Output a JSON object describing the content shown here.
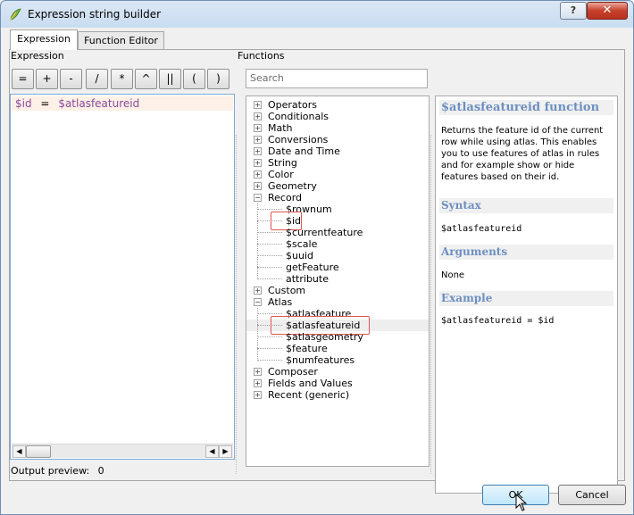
{
  "window": {
    "title": "Expression string builder"
  },
  "tabs": [
    {
      "label": "Expression",
      "active": true
    },
    {
      "label": "Function Editor",
      "active": false
    }
  ],
  "expression": {
    "section_label": "Expression",
    "operators": [
      "=",
      "+",
      "-",
      "/",
      "*",
      "^",
      "||",
      "(",
      ")"
    ],
    "text_var1": "$id",
    "text_op": "=",
    "text_var2": "$atlasfeatureid",
    "output_preview_label": "Output preview:",
    "output_preview_value": "0"
  },
  "functions": {
    "section_label": "Functions",
    "search_placeholder": "Search",
    "tree": [
      {
        "label": "Operators",
        "level": 0,
        "expander": "+"
      },
      {
        "label": "Conditionals",
        "level": 0,
        "expander": "+"
      },
      {
        "label": "Math",
        "level": 0,
        "expander": "+"
      },
      {
        "label": "Conversions",
        "level": 0,
        "expander": "+"
      },
      {
        "label": "Date and Time",
        "level": 0,
        "expander": "+"
      },
      {
        "label": "String",
        "level": 0,
        "expander": "+"
      },
      {
        "label": "Color",
        "level": 0,
        "expander": "+"
      },
      {
        "label": "Geometry",
        "level": 0,
        "expander": "+"
      },
      {
        "label": "Record",
        "level": 0,
        "expander": "-"
      },
      {
        "label": "$rownum",
        "level": 1
      },
      {
        "label": "$id",
        "level": 1,
        "highlighted": true
      },
      {
        "label": "$currentfeature",
        "level": 1
      },
      {
        "label": "$scale",
        "level": 1
      },
      {
        "label": "$uuid",
        "level": 1
      },
      {
        "label": "getFeature",
        "level": 1
      },
      {
        "label": "attribute",
        "level": 1
      },
      {
        "label": "Custom",
        "level": 0,
        "expander": "+"
      },
      {
        "label": "Atlas",
        "level": 0,
        "expander": "-"
      },
      {
        "label": "$atlasfeature",
        "level": 1
      },
      {
        "label": "$atlasfeatureid",
        "level": 1,
        "selected": true,
        "highlighted": true
      },
      {
        "label": "$atlasgeometry",
        "level": 1
      },
      {
        "label": "$feature",
        "level": 1
      },
      {
        "label": "$numfeatures",
        "level": 1
      },
      {
        "label": "Composer",
        "level": 0,
        "expander": "+"
      },
      {
        "label": "Fields and Values",
        "level": 0,
        "expander": "+"
      },
      {
        "label": "Recent (generic)",
        "level": 0,
        "expander": "+"
      }
    ]
  },
  "help": {
    "title": "$atlasfeatureid function",
    "description": "Returns the feature id of the current row while using atlas. This enables you to use features of atlas in rules and for example show or hide features based on their id.",
    "syntax_heading": "Syntax",
    "syntax": "$atlasfeatureid",
    "arguments_heading": "Arguments",
    "arguments": "None",
    "example_heading": "Example",
    "example": "$atlasfeatureid = $id"
  },
  "buttons": {
    "ok": "OK",
    "cancel": "Cancel"
  },
  "colors": {
    "help_heading": "#6d8fc1",
    "highlight_box": "#e05555",
    "expression_var": "#8a4a9e"
  }
}
